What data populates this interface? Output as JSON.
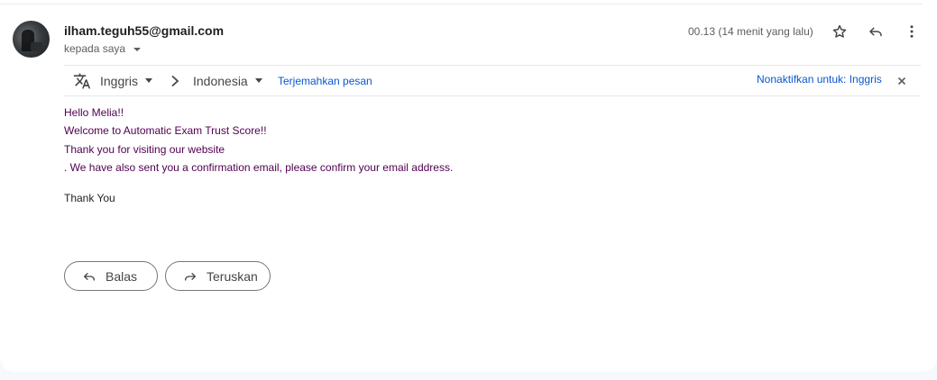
{
  "message": {
    "sender": "ilham.teguh55@gmail.com",
    "recipient_label": "kepada saya",
    "timestamp": "00.13 (14 menit yang lalu)"
  },
  "icons": {
    "star": "star-icon",
    "reply": "reply-icon",
    "more": "more-vert-icon",
    "translate": "translate-icon",
    "arrow": "chevron-right-icon",
    "close": "close-icon",
    "forward": "forward-icon"
  },
  "translate_bar": {
    "source_language": "Inggris",
    "target_language": "Indonesia",
    "translate_link": "Terjemahkan pesan",
    "disable_link": "Nonaktifkan untuk: Inggris"
  },
  "body": {
    "lines": [
      "Hello Melia!!",
      "Welcome to Automatic Exam Trust Score!!",
      "Thank you for visiting our website",
      ". We have also sent you a confirmation email, please confirm your email address."
    ],
    "closing": "Thank You"
  },
  "actions": {
    "reply_label": "Balas",
    "forward_label": "Teruskan"
  },
  "colors": {
    "body_text": "#500050",
    "link": "#0b57d0",
    "background": "#f6f8fc"
  }
}
